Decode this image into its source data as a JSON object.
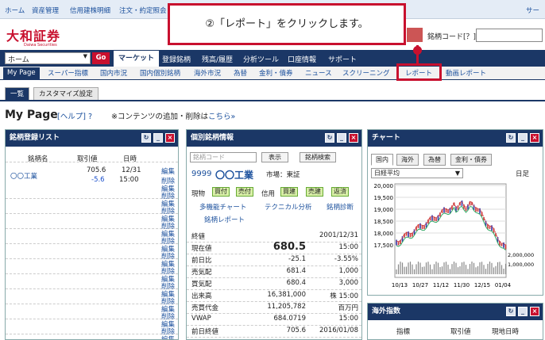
{
  "util": {
    "links": [
      "ホーム",
      "資産管理",
      "信用建株明細",
      "注文・約定照会"
    ],
    "right": "サー"
  },
  "logo": {
    "name": "大和証券",
    "sub": "Daiwa Securities"
  },
  "code": {
    "label": "銘柄コード[？]"
  },
  "callout": "②「レポート」をクリックします。",
  "nav": {
    "select": "ホーム",
    "go": "Go",
    "items": [
      "マーケット",
      "登録銘柄",
      "残高/履歴",
      "分析ツール",
      "口座情報",
      "サポート"
    ]
  },
  "subnav": {
    "mypage": "My Page",
    "items": [
      "スーパー指標",
      "国内市況",
      "国内個別銘柄",
      "海外市況",
      "為替",
      "金利・債券",
      "ニュース",
      "スクリーニング",
      "レポート",
      "動画レポート"
    ]
  },
  "tabs": [
    "一覧",
    "カスタマイズ設定"
  ],
  "page": {
    "title": "My Page",
    "help": "[ヘルプ]",
    "note": "※コンテンツの追加・削除は",
    "note_link": "こちら»"
  },
  "watch": {
    "title": "銘柄登録リスト",
    "cols": [
      "銘柄名",
      "取引値",
      "日時"
    ],
    "name": "〇〇工業",
    "price": "705.6",
    "chg": "-5.6",
    "date": "12/31",
    "time": "15:00",
    "edit": "編集",
    "del": "削除",
    "empty_rows": 11
  },
  "stock": {
    "title": "個別銘柄情報",
    "placeholder": "銘柄コード",
    "show": "表示",
    "search": "銘柄検索",
    "code": "9999",
    "name": "〇〇工業",
    "market": "市場：東証",
    "trade": [
      "現物",
      "買付",
      "売付",
      "信用",
      "買建",
      "売建",
      "返済"
    ],
    "links": [
      "多機能チャート",
      "テクニカル分析",
      "銘柄診断",
      "銘柄レポート"
    ],
    "rows": [
      [
        "終値",
        "",
        "2001/12/31"
      ],
      [
        "現在値",
        "680.5",
        "15:00"
      ],
      [
        "前日比",
        "-25.1",
        "-3.55%"
      ],
      [
        "売気配",
        "681.4",
        "1,000"
      ],
      [
        "買気配",
        "680.4",
        "3,000"
      ],
      [
        "出来高",
        "16,381,000",
        "株 15:00"
      ],
      [
        "売買代金",
        "11,205,782",
        "百万円"
      ],
      [
        "VWAP",
        "684.0719",
        "15:00"
      ],
      [
        "前日終値",
        "705.6",
        "2016/01/08"
      ]
    ]
  },
  "chart": {
    "title": "チャート",
    "tabs": [
      "国内",
      "海外",
      "為替",
      "金利・債券"
    ],
    "index": "日経平均",
    "period": "日足"
  },
  "chart_data": {
    "type": "line",
    "y_ticks": [
      "20,000",
      "19,500",
      "19,000",
      "18,500",
      "18,000",
      "17,500"
    ],
    "vol_ticks": [
      "2,000,000",
      "1,000,000"
    ],
    "x_ticks": [
      "10/13",
      "10/27",
      "11/12",
      "11/30",
      "12/15",
      "01/04"
    ],
    "ylim": [
      17500,
      20000
    ]
  },
  "overseas": {
    "title": "海外指数",
    "cols": [
      "指標",
      "取引値",
      "現地日時"
    ]
  }
}
